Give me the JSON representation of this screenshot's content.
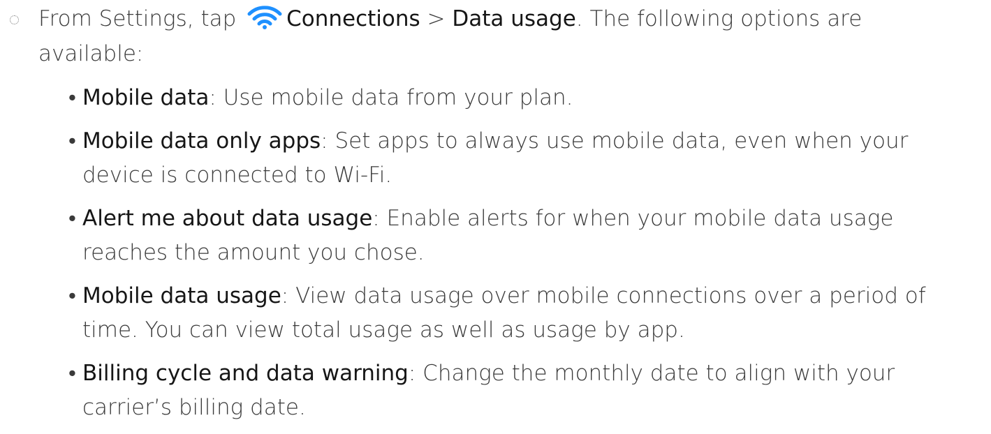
{
  "step": {
    "prefix": "From Settings, tap ",
    "icon": "wifi-icon",
    "icon_color": "#1e90ff",
    "path_1": "Connections",
    "separator": " > ",
    "path_2": "Data usage",
    "suffix": ". The following options are available:"
  },
  "options": [
    {
      "term": "Mobile data",
      "desc": ": Use mobile data from your plan."
    },
    {
      "term": "Mobile data only apps",
      "desc": ": Set apps to always use mobile data, even when your device is connected to Wi-Fi."
    },
    {
      "term": "Alert me about data usage",
      "desc": ": Enable alerts for when your mobile data usage reaches the amount you chose."
    },
    {
      "term": "Mobile data usage",
      "desc": ": View data usage over mobile connections over a period of time. You can view total usage as well as usage by app."
    },
    {
      "term": "Billing cycle and data warning",
      "desc": ": Change the monthly date to align with your carrier’s billing date."
    }
  ]
}
